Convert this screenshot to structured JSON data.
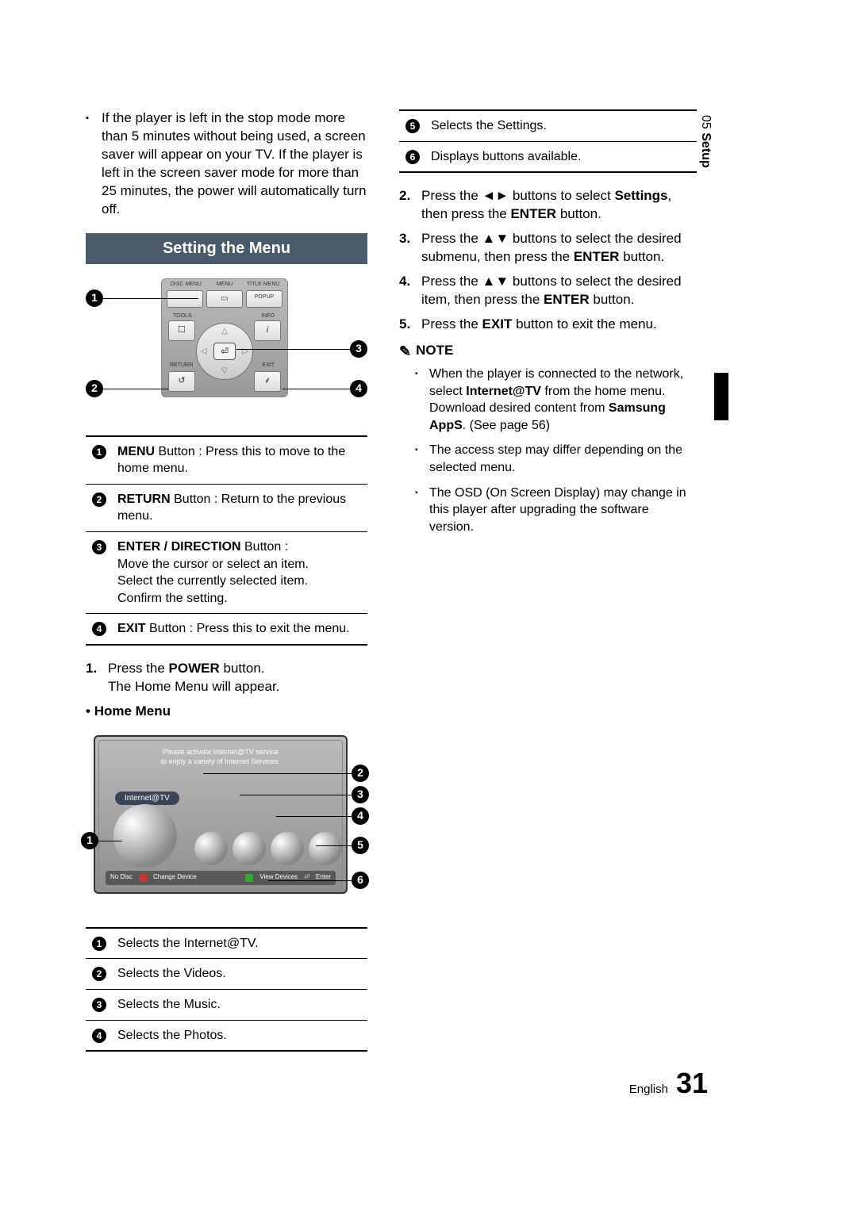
{
  "side_tab": {
    "chapter": "05",
    "label": "Setup"
  },
  "top_bullet": "If the player is left in the stop mode more than 5 minutes without being used, a screen saver will appear on your TV. If the player is left in the screen saver mode for more than 25 minutes, the power will automatically turn off.",
  "section_title": "Setting the Menu",
  "remote": {
    "top_labels": [
      "DISC MENU",
      "MENU",
      "TITLE MENU"
    ],
    "top_btn_popup": "POPUP",
    "tools_label": "TOOLS",
    "info_label": "INFO",
    "return_label": "RETURN",
    "exit_label": "EXIT",
    "callouts": {
      "c1": "1",
      "c2": "2",
      "c3": "3",
      "c4": "4"
    }
  },
  "remote_table": [
    {
      "num": "1",
      "text_b": "MENU",
      "text": " Button : Press this to move to the home menu."
    },
    {
      "num": "2",
      "text_b": "RETURN",
      "text": " Button : Return to the previous menu."
    },
    {
      "num": "3",
      "text_b": "ENTER / DIRECTION",
      "text": " Button :\nMove the cursor or select an item.\nSelect the currently selected item.\nConfirm the setting."
    },
    {
      "num": "4",
      "text_b": "EXIT",
      "text": " Button : Press this to exit the menu."
    }
  ],
  "step1": {
    "n": "1.",
    "pre": "Press the ",
    "b": "POWER",
    "post": " button.",
    "line2": "The Home Menu will appear."
  },
  "home_menu_label": "Home Menu",
  "tv": {
    "msg1": "Please activate Internet@TV service",
    "msg2": "to enjoy a variety of Internet Services.",
    "pill": "Internet@TV",
    "foot_nodisc": "No Disc",
    "foot_a": "Change Device",
    "foot_d": "View Devices",
    "foot_enter": "Enter"
  },
  "home_callouts": {
    "c1": "1",
    "c2": "2",
    "c3": "3",
    "c4": "4",
    "c5": "5",
    "c6": "6"
  },
  "home_table": [
    {
      "num": "1",
      "text": "Selects the Internet@TV."
    },
    {
      "num": "2",
      "text": "Selects the Videos."
    },
    {
      "num": "3",
      "text": "Selects the Music."
    },
    {
      "num": "4",
      "text": "Selects the Photos."
    }
  ],
  "right_mini_table": [
    {
      "num": "5",
      "text": "Selects the Settings."
    },
    {
      "num": "6",
      "text": "Displays buttons available."
    }
  ],
  "step2": {
    "n": "2.",
    "pre": "Press the ",
    "arr": "◄►",
    "mid": " buttons to select ",
    "b1": "Settings",
    "mid2": ", then press the ",
    "b2": "ENTER",
    "post": " button."
  },
  "step3": {
    "n": "3.",
    "pre": "Press the ",
    "arr": "▲▼",
    "mid": " buttons to select the desired submenu, then press the ",
    "b": "ENTER",
    "post": " button."
  },
  "step4": {
    "n": "4.",
    "pre": "Press the ",
    "arr": "▲▼",
    "mid": " buttons to select the desired item, then press the ",
    "b": "ENTER",
    "post": " button."
  },
  "step5": {
    "n": "5.",
    "pre": "Press the ",
    "b": "EXIT",
    "post": " button to exit the menu."
  },
  "note_label": "NOTE",
  "notes": {
    "n1a": "When the player is connected to the network, select ",
    "n1b": "Internet@TV",
    "n1c": " from the home menu.",
    "n1d": "Download desired content from ",
    "n1e": "Samsung AppS",
    "n1f": ". (See page 56)",
    "n2": "The access step may differ depending on the selected menu.",
    "n3": "The OSD (On Screen Display) may change in this player after upgrading the software version."
  },
  "footer": {
    "lang": "English",
    "page": "31"
  }
}
